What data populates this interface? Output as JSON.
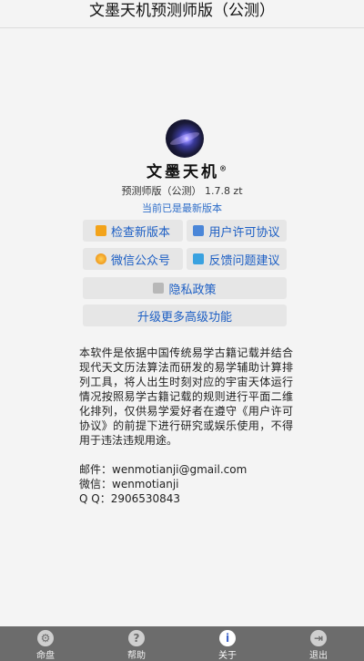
{
  "app": {
    "title": "文墨天机预测师版（公测）"
  },
  "logo": {
    "name": "文墨天机",
    "reg": "®"
  },
  "version_text": "预测师版（公测） 1.7.8 zt",
  "latest_text": "当前已是最新版本",
  "buttons": {
    "check_update": "检查新版本",
    "license": "用户许可协议",
    "wechat": "微信公众号",
    "feedback": "反馈问题建议",
    "privacy": "隐私政策",
    "upgrade": "升级更多高级功能"
  },
  "about": {
    "body": "本软件是依据中国传统易学古籍记载并结合现代天文历法算法而研发的易学辅助计算排列工具，将人出生时刻对应的宇宙天体运行情况按照易学古籍记载的规则进行平面二维化排列，仅供易学爱好者在遵守《用户许可协议》的前提下进行研究或娱乐使用，不得用于违法违规用途。"
  },
  "contact": {
    "email": "邮件：wenmotianji@gmail.com",
    "wechat": "微信：wenmotianji",
    "qq": "Q Q：2906530843"
  },
  "tabs": [
    {
      "label": "命盘",
      "icon": "gear-icon"
    },
    {
      "label": "帮助",
      "icon": "help-icon"
    },
    {
      "label": "关于",
      "icon": "info-icon"
    },
    {
      "label": "退出",
      "icon": "exit-icon"
    }
  ],
  "colors": {
    "accent": "#1d5fc4",
    "tabbar": "#6c6c6c"
  }
}
